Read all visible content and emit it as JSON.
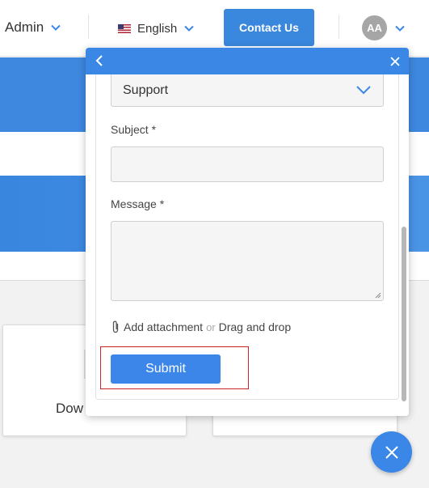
{
  "nav": {
    "admin_label": "Admin",
    "language_label": "English",
    "contact_label": "Contact Us",
    "avatar_initials": "AA"
  },
  "background": {
    "card_left_label": "Dow"
  },
  "form": {
    "category_value": "Support",
    "subject_label": "Subject *",
    "message_label": "Message *",
    "attach_label": "Add attachment",
    "or_label": "or",
    "drag_label": "Drag and drop",
    "submit_label": "Submit"
  },
  "colors": {
    "primary": "#3a87e6",
    "highlight_outline": "#cf2222"
  },
  "icons": [
    "chevron-down-icon",
    "us-flag-icon",
    "back-chevron-icon",
    "close-icon",
    "paperclip-icon",
    "fab-close-icon"
  ]
}
